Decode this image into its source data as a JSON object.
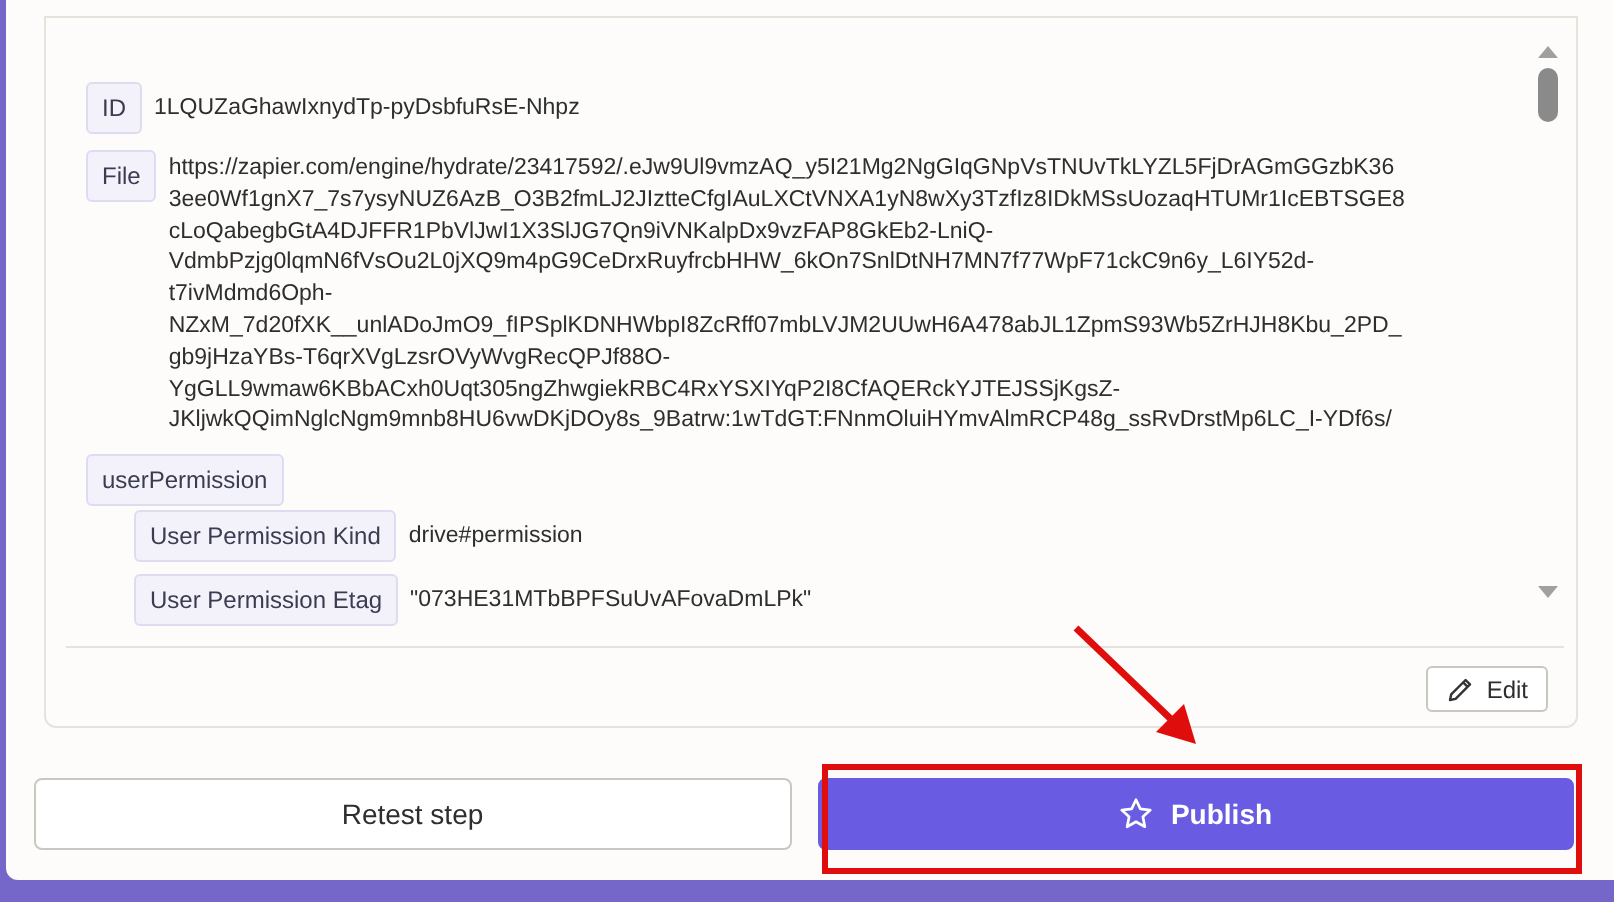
{
  "fields": [
    {
      "kind": "text",
      "label": "ID",
      "lines": [
        "1LQUZaGhawIxnydTp-pyDsbfuRsE-Nhpz"
      ]
    },
    {
      "kind": "text",
      "label": "File",
      "lines": [
        "https://zapier.com/engine/hydrate/23417592/.eJw9Ul9vmzAQ_y5I21Mg2NgGIqGNpVsTNUvTkLYZL5FjDrAGmGGzbK36",
        "3ee0Wf1gnX7_7s7ysyNUZ6AzB_O3B2fmLJ2JIztteCfgIAuLXCtVNXA1yN8wXy3TzfIz8IDkMSsUozaqHTUMr1IcEBTSGE8",
        "cLoQabegbGtA4DJFFR1PbVlJwI1X3SlJG7Qn9iVNKalpDx9vzFAP8GkEb2-LniQ-",
        "VdmbPzjg0lqmN6fVsOu2L0jXQ9m4pG9CeDrxRuyfrcbHHW_6kOn7SnlDtNH7MN7f77WpF71ckC9n6y_L6IY52d-",
        "t7ivMdmd6Oph-",
        "NZxM_7d20fXK__unlADoJmO9_fIPSplKDNHWbpI8ZcRff07mbLVJM2UUwH6A478abJL1ZpmS93Wb5ZrHJH8Kbu_2PD_",
        "gb9jHzaYBs-T6qrXVgLzsrOVyWvgRecQPJf88O-",
        "YgGLL9wmaw6KBbACxh0Uqt305ngZhwgiekRBC4RxYSXIYqP2I8CfAQERckYJTEJSSjKgsZ-",
        "JKljwkQQimNglcNgm9mnb8HU6vwDKjDOy8s_9Batrw:1wTdGT:FNnmOluiHYmvAlmRCP48g_ssRvDrstMp6LC_I-YDf6s/"
      ]
    },
    {
      "kind": "group",
      "label": "userPermission",
      "children": [
        {
          "label": "User Permission Kind",
          "value": "drive#permission"
        },
        {
          "label": "User Permission Etag",
          "value": "\"073HE31MTbBPFSuUvAFovaDmLPk\""
        }
      ]
    }
  ],
  "edit_button": "Edit",
  "retest_button": "Retest step",
  "publish_button": "Publish"
}
